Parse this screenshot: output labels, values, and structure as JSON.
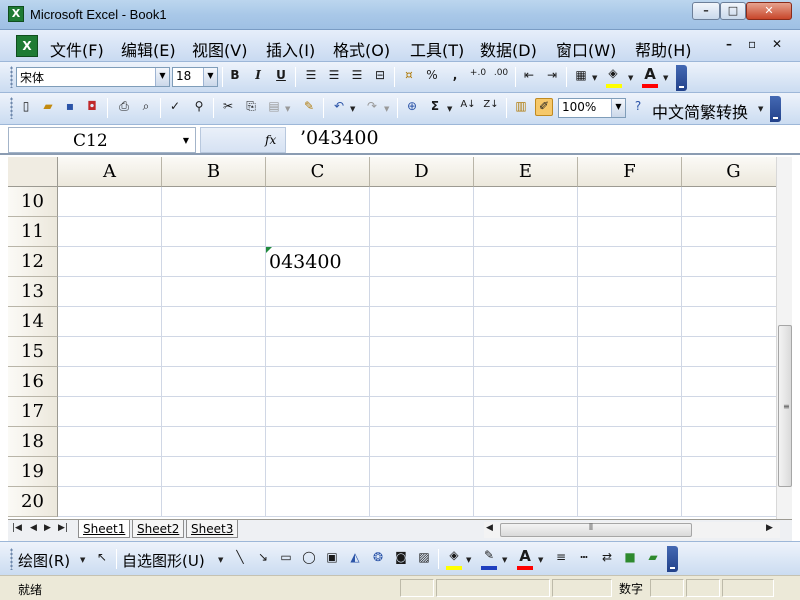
{
  "window": {
    "title": "Microsoft Excel - Book1",
    "app_icon": "excel-icon",
    "min_label": "–",
    "max_label": "□",
    "close_label": "✕"
  },
  "menu": {
    "items": [
      "文件(F)",
      "编辑(E)",
      "视图(V)",
      "插入(I)",
      "格式(O)",
      "工具(T)",
      "数据(D)",
      "窗口(W)",
      "帮助(H)"
    ],
    "mdi_min": "–",
    "mdi_restore": "▫",
    "mdi_close": "✕"
  },
  "format_toolbar": {
    "font": "宋体",
    "size": "18",
    "bold": "B",
    "italic": "I",
    "underline": "U",
    "percent": "%",
    "comma": ","
  },
  "standard_toolbar": {
    "zoom": "100%",
    "sum": "Σ",
    "convert_label": "中文简繁转换"
  },
  "formula_bar": {
    "name_box": "C12",
    "fx": "fx",
    "content": "’043400"
  },
  "grid": {
    "columns": [
      "A",
      "B",
      "C",
      "D",
      "E",
      "F",
      "G"
    ],
    "rows": [
      "10",
      "11",
      "12",
      "13",
      "14",
      "15",
      "16",
      "17",
      "18",
      "19",
      "20"
    ],
    "cells": [
      {
        "ref": "C12",
        "value": "043400",
        "warning": true
      }
    ]
  },
  "sheets": {
    "tabs": [
      "Sheet1",
      "Sheet2",
      "Sheet3"
    ],
    "active": "Sheet1"
  },
  "draw_toolbar": {
    "draw_label": "绘图(R)",
    "autoshapes_label": "自选图形(U)"
  },
  "status": {
    "ready": "就绪",
    "mode": "数字"
  },
  "colors": {
    "highlight": "#ffff00",
    "font_color": "#ff0000",
    "line_color": "#1f3fbf"
  }
}
